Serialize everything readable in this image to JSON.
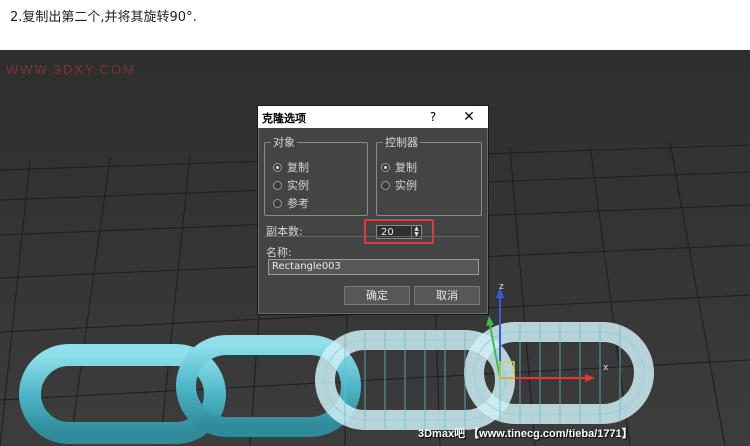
{
  "caption": "2.复制出第二个,并将其旋转90°.",
  "watermark": "WWW.3DXY.COM",
  "footer_watermark": "3Dmax吧 【www.tinecg.com/tieba/1771】",
  "dialog": {
    "title": "克隆选项",
    "help": "?",
    "close": "✕",
    "object_group": {
      "legend": "对象",
      "options": [
        {
          "label": "复制",
          "selected": true
        },
        {
          "label": "实例",
          "selected": false
        },
        {
          "label": "参考",
          "selected": false
        }
      ]
    },
    "controller_group": {
      "legend": "控制器",
      "options": [
        {
          "label": "复制",
          "selected": true
        },
        {
          "label": "实例",
          "selected": false
        }
      ]
    },
    "copies_label": "副本数:",
    "copies_value": "20",
    "name_label": "名称:",
    "name_value": "Rectangle003",
    "ok_label": "确定",
    "cancel_label": "取消"
  },
  "gizmo": {
    "x_label": "x",
    "z_label": "z"
  },
  "colors": {
    "chain_solid": "#5fc4d4",
    "chain_wire": "#d9f3f7",
    "highlight": "#e23b3b",
    "viewport_bg": "#333333"
  }
}
